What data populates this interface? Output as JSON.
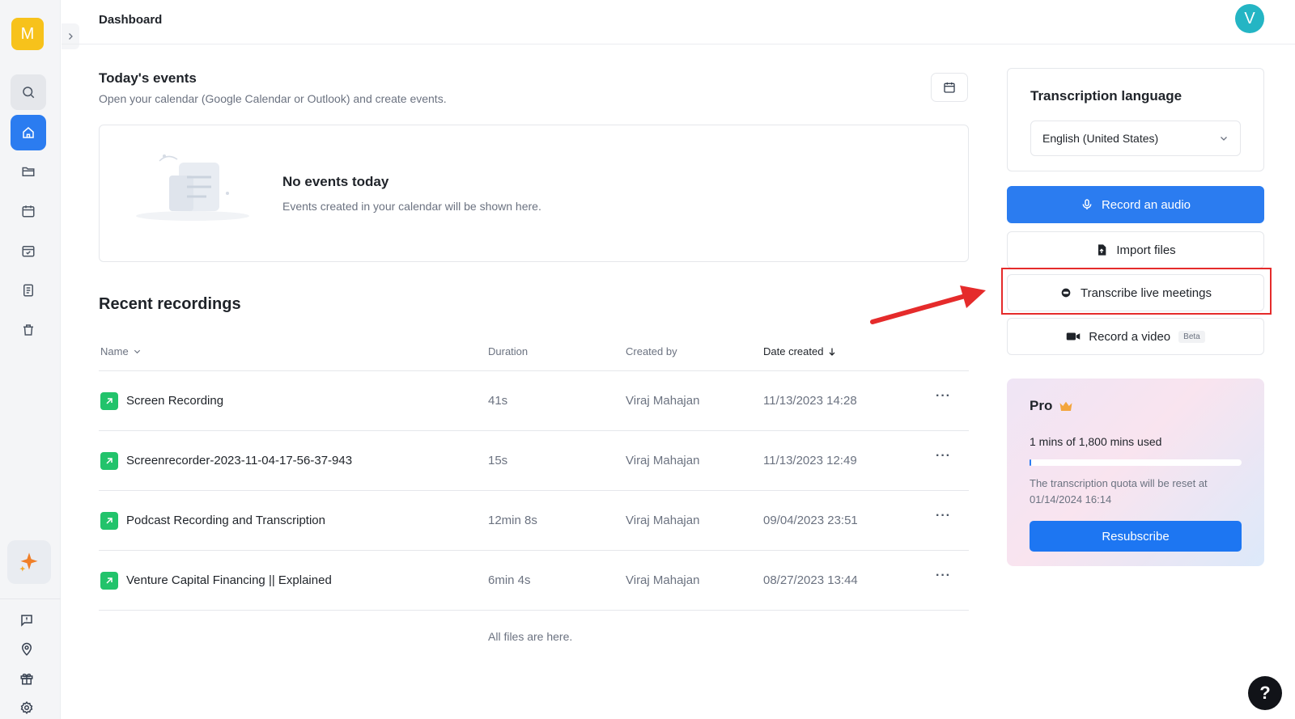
{
  "app": {
    "logo_letter": "M",
    "page_title": "Dashboard",
    "user_initial": "V"
  },
  "sidebar": {
    "items": [
      {
        "name": "search",
        "icon": "search-icon"
      },
      {
        "name": "home",
        "icon": "home-icon",
        "active": true
      },
      {
        "name": "files",
        "icon": "folder-icon"
      },
      {
        "name": "calendar",
        "icon": "calendar-icon"
      },
      {
        "name": "schedule",
        "icon": "calendar-check-icon"
      },
      {
        "name": "notes",
        "icon": "document-icon"
      },
      {
        "name": "trash",
        "icon": "trash-icon"
      }
    ],
    "bottom": [
      "feedback-icon",
      "location-pin-icon",
      "gift-icon",
      "settings-icon"
    ]
  },
  "events": {
    "title": "Today's events",
    "subtitle": "Open your calendar (Google Calendar or Outlook) and create events.",
    "empty_title": "No events today",
    "empty_subtitle": "Events created in your calendar will be shown here."
  },
  "recordings": {
    "title": "Recent recordings",
    "columns": {
      "name": "Name",
      "duration": "Duration",
      "created_by": "Created by",
      "date_created": "Date created"
    },
    "rows": [
      {
        "name": "Screen Recording",
        "duration": "41s",
        "created_by": "Viraj Mahajan",
        "date": "11/13/2023 14:28"
      },
      {
        "name": "Screenrecorder-2023-11-04-17-56-37-943",
        "duration": "15s",
        "created_by": "Viraj Mahajan",
        "date": "11/13/2023 12:49"
      },
      {
        "name": "Podcast Recording and Transcription",
        "duration": "12min 8s",
        "created_by": "Viraj Mahajan",
        "date": "09/04/2023 23:51"
      },
      {
        "name": "Venture Capital Financing || Explained",
        "duration": "6min 4s",
        "created_by": "Viraj Mahajan",
        "date": "08/27/2023 13:44"
      }
    ],
    "more_label": "···",
    "footer": "All files are here."
  },
  "transcription": {
    "title": "Transcription language",
    "selected_language": "English (United States)"
  },
  "actions": {
    "record_audio": "Record an audio",
    "import_files": "Import files",
    "transcribe_live": "Transcribe live meetings",
    "record_video": "Record a video",
    "beta_label": "Beta"
  },
  "plan": {
    "name": "Pro",
    "usage": "1 mins of 1,800 mins used",
    "usage_fraction": 0.0006,
    "reset_note": "The transcription quota will be reset at 01/14/2024 16:14",
    "resubscribe": "Resubscribe"
  },
  "help_label": "?",
  "colors": {
    "accent": "#2b7cf0",
    "logo": "#f7c21b",
    "avatar": "#24b5c4",
    "file_icon": "#22c36b",
    "highlight": "#e52b2b"
  }
}
